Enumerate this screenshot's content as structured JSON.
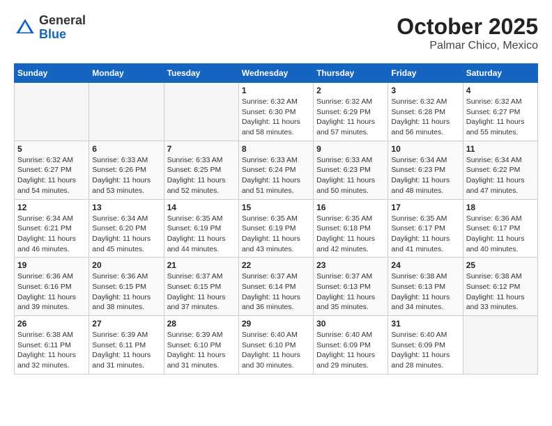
{
  "header": {
    "logo_general": "General",
    "logo_blue": "Blue",
    "title": "October 2025",
    "subtitle": "Palmar Chico, Mexico"
  },
  "weekdays": [
    "Sunday",
    "Monday",
    "Tuesday",
    "Wednesday",
    "Thursday",
    "Friday",
    "Saturday"
  ],
  "weeks": [
    [
      {
        "day": "",
        "info": ""
      },
      {
        "day": "",
        "info": ""
      },
      {
        "day": "",
        "info": ""
      },
      {
        "day": "1",
        "info": "Sunrise: 6:32 AM\nSunset: 6:30 PM\nDaylight: 11 hours\nand 58 minutes."
      },
      {
        "day": "2",
        "info": "Sunrise: 6:32 AM\nSunset: 6:29 PM\nDaylight: 11 hours\nand 57 minutes."
      },
      {
        "day": "3",
        "info": "Sunrise: 6:32 AM\nSunset: 6:28 PM\nDaylight: 11 hours\nand 56 minutes."
      },
      {
        "day": "4",
        "info": "Sunrise: 6:32 AM\nSunset: 6:27 PM\nDaylight: 11 hours\nand 55 minutes."
      }
    ],
    [
      {
        "day": "5",
        "info": "Sunrise: 6:32 AM\nSunset: 6:27 PM\nDaylight: 11 hours\nand 54 minutes."
      },
      {
        "day": "6",
        "info": "Sunrise: 6:33 AM\nSunset: 6:26 PM\nDaylight: 11 hours\nand 53 minutes."
      },
      {
        "day": "7",
        "info": "Sunrise: 6:33 AM\nSunset: 6:25 PM\nDaylight: 11 hours\nand 52 minutes."
      },
      {
        "day": "8",
        "info": "Sunrise: 6:33 AM\nSunset: 6:24 PM\nDaylight: 11 hours\nand 51 minutes."
      },
      {
        "day": "9",
        "info": "Sunrise: 6:33 AM\nSunset: 6:23 PM\nDaylight: 11 hours\nand 50 minutes."
      },
      {
        "day": "10",
        "info": "Sunrise: 6:34 AM\nSunset: 6:23 PM\nDaylight: 11 hours\nand 48 minutes."
      },
      {
        "day": "11",
        "info": "Sunrise: 6:34 AM\nSunset: 6:22 PM\nDaylight: 11 hours\nand 47 minutes."
      }
    ],
    [
      {
        "day": "12",
        "info": "Sunrise: 6:34 AM\nSunset: 6:21 PM\nDaylight: 11 hours\nand 46 minutes."
      },
      {
        "day": "13",
        "info": "Sunrise: 6:34 AM\nSunset: 6:20 PM\nDaylight: 11 hours\nand 45 minutes."
      },
      {
        "day": "14",
        "info": "Sunrise: 6:35 AM\nSunset: 6:19 PM\nDaylight: 11 hours\nand 44 minutes."
      },
      {
        "day": "15",
        "info": "Sunrise: 6:35 AM\nSunset: 6:19 PM\nDaylight: 11 hours\nand 43 minutes."
      },
      {
        "day": "16",
        "info": "Sunrise: 6:35 AM\nSunset: 6:18 PM\nDaylight: 11 hours\nand 42 minutes."
      },
      {
        "day": "17",
        "info": "Sunrise: 6:35 AM\nSunset: 6:17 PM\nDaylight: 11 hours\nand 41 minutes."
      },
      {
        "day": "18",
        "info": "Sunrise: 6:36 AM\nSunset: 6:17 PM\nDaylight: 11 hours\nand 40 minutes."
      }
    ],
    [
      {
        "day": "19",
        "info": "Sunrise: 6:36 AM\nSunset: 6:16 PM\nDaylight: 11 hours\nand 39 minutes."
      },
      {
        "day": "20",
        "info": "Sunrise: 6:36 AM\nSunset: 6:15 PM\nDaylight: 11 hours\nand 38 minutes."
      },
      {
        "day": "21",
        "info": "Sunrise: 6:37 AM\nSunset: 6:15 PM\nDaylight: 11 hours\nand 37 minutes."
      },
      {
        "day": "22",
        "info": "Sunrise: 6:37 AM\nSunset: 6:14 PM\nDaylight: 11 hours\nand 36 minutes."
      },
      {
        "day": "23",
        "info": "Sunrise: 6:37 AM\nSunset: 6:13 PM\nDaylight: 11 hours\nand 35 minutes."
      },
      {
        "day": "24",
        "info": "Sunrise: 6:38 AM\nSunset: 6:13 PM\nDaylight: 11 hours\nand 34 minutes."
      },
      {
        "day": "25",
        "info": "Sunrise: 6:38 AM\nSunset: 6:12 PM\nDaylight: 11 hours\nand 33 minutes."
      }
    ],
    [
      {
        "day": "26",
        "info": "Sunrise: 6:38 AM\nSunset: 6:11 PM\nDaylight: 11 hours\nand 32 minutes."
      },
      {
        "day": "27",
        "info": "Sunrise: 6:39 AM\nSunset: 6:11 PM\nDaylight: 11 hours\nand 31 minutes."
      },
      {
        "day": "28",
        "info": "Sunrise: 6:39 AM\nSunset: 6:10 PM\nDaylight: 11 hours\nand 31 minutes."
      },
      {
        "day": "29",
        "info": "Sunrise: 6:40 AM\nSunset: 6:10 PM\nDaylight: 11 hours\nand 30 minutes."
      },
      {
        "day": "30",
        "info": "Sunrise: 6:40 AM\nSunset: 6:09 PM\nDaylight: 11 hours\nand 29 minutes."
      },
      {
        "day": "31",
        "info": "Sunrise: 6:40 AM\nSunset: 6:09 PM\nDaylight: 11 hours\nand 28 minutes."
      },
      {
        "day": "",
        "info": ""
      }
    ]
  ]
}
